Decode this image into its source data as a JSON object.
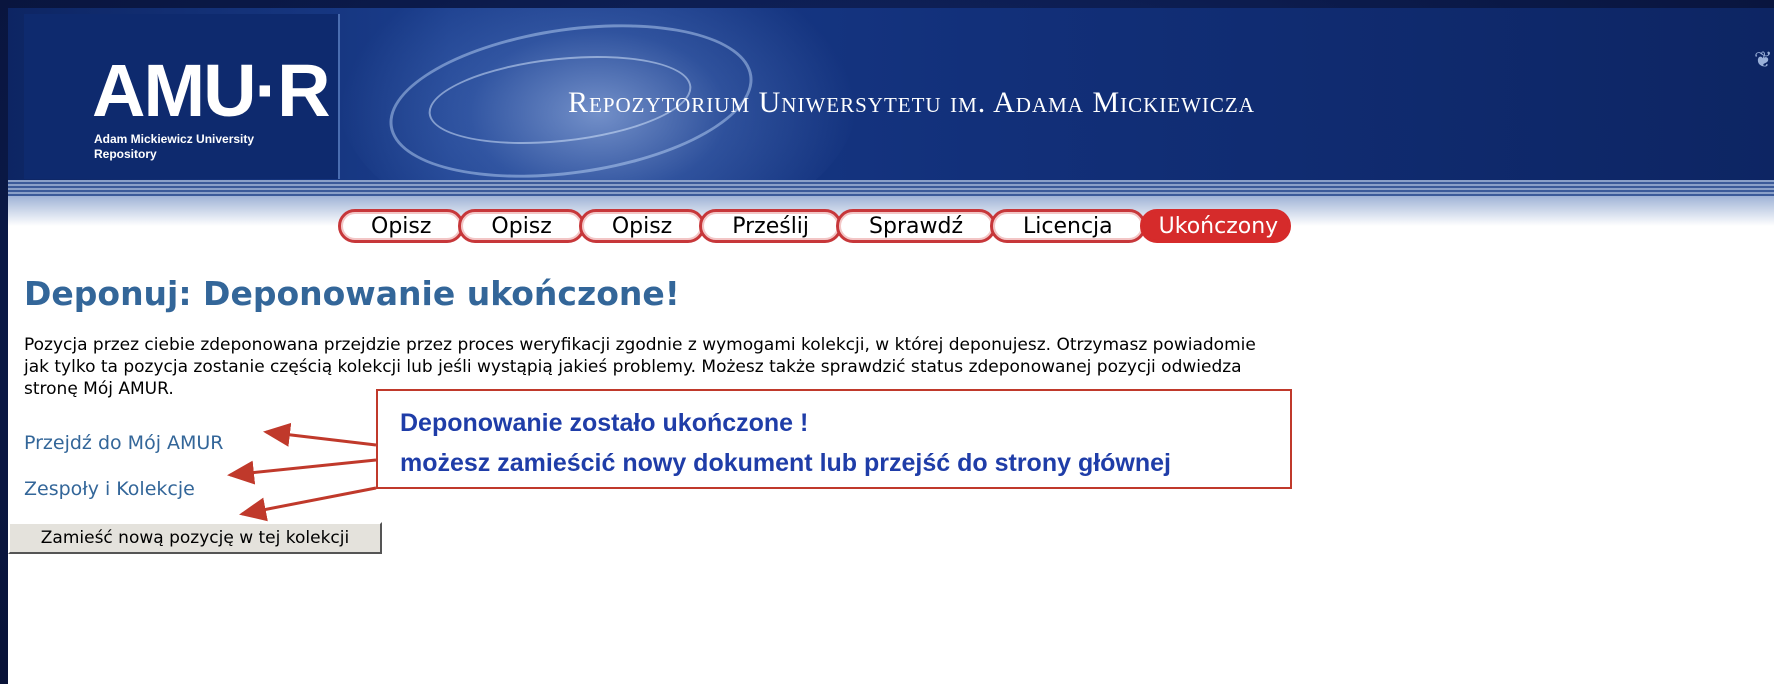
{
  "header": {
    "logo_text": "AMU·R",
    "logo_subtitle": "Adam Mickiewicz University Repository",
    "title": "Repozytorium Uniwersytetu im. Adama Mickiewicza"
  },
  "steps": [
    {
      "label": "Opisz",
      "active": false
    },
    {
      "label": "Opisz",
      "active": false
    },
    {
      "label": "Opisz",
      "active": false
    },
    {
      "label": "Prześlij",
      "active": false
    },
    {
      "label": "Sprawdź",
      "active": false
    },
    {
      "label": "Licencja",
      "active": false
    },
    {
      "label": "Ukończony",
      "active": true
    }
  ],
  "main": {
    "heading": "Deponuj: Deponowanie ukończone!",
    "paragraph_lines": [
      "Pozycja przez ciebie zdeponowana przejdzie przez proces weryfikacji zgodnie z wymogami kolekcji, w której deponujesz. Otrzymasz powiadomie",
      "jak tylko ta pozycja zostanie częścią kolekcji lub jeśli wystąpią jakieś problemy. Możesz także sprawdzić status zdeponowanej pozycji odwiedza",
      "stronę Mój AMUR."
    ],
    "link_my_amur": "Przejdź do Mój AMUR",
    "link_communities": "Zespoły i Kolekcje",
    "button_new_item": "Zamieść nową pozycję w tej kolekcji"
  },
  "annotation": {
    "line1": "Deponowanie zostało ukończone !",
    "line2": "możesz zamieścić nowy dokument lub przejść do strony głównej"
  },
  "colors": {
    "heading": "#336699",
    "link": "#336699",
    "active_step": "#d62b2b",
    "callout_text": "#1f3da8",
    "callout_border": "#c0392b"
  }
}
